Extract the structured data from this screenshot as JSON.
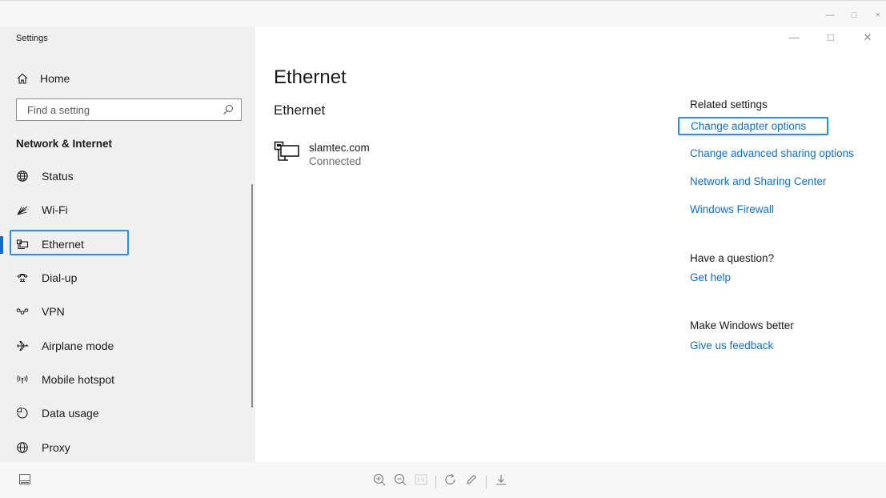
{
  "viewer": {
    "window_controls": [
      "—",
      "□",
      "×"
    ]
  },
  "window": {
    "title": "Settings",
    "controls": {
      "minimize": "—",
      "maximize": "□",
      "close": "✕"
    }
  },
  "sidebar": {
    "home_label": "Home",
    "search_placeholder": "Find a setting",
    "section_title": "Network & Internet",
    "items": [
      {
        "label": "Status",
        "icon": "status-globe-icon"
      },
      {
        "label": "Wi-Fi",
        "icon": "wifi-icon"
      },
      {
        "label": "Ethernet",
        "icon": "ethernet-icon",
        "active": true
      },
      {
        "label": "Dial-up",
        "icon": "dialup-icon"
      },
      {
        "label": "VPN",
        "icon": "vpn-icon"
      },
      {
        "label": "Airplane mode",
        "icon": "airplane-icon"
      },
      {
        "label": "Mobile hotspot",
        "icon": "hotspot-icon"
      },
      {
        "label": "Data usage",
        "icon": "data-usage-icon"
      },
      {
        "label": "Proxy",
        "icon": "proxy-globe-icon"
      }
    ]
  },
  "main": {
    "heading": "Ethernet",
    "subheading": "Ethernet",
    "connection": {
      "name": "slamtec.com",
      "status": "Connected"
    }
  },
  "related": {
    "header": "Related settings",
    "links": [
      "Change adapter options",
      "Change advanced sharing options",
      "Network and Sharing Center",
      "Windows Firewall"
    ],
    "question_header": "Have a question?",
    "help_link": "Get help",
    "better_header": "Make Windows better",
    "feedback_link": "Give us feedback"
  },
  "colors": {
    "accent": "#0a6cd6",
    "link": "#1170c6",
    "focus_border": "#2d8ef0",
    "sidebar_bg": "#f0f0f0"
  }
}
